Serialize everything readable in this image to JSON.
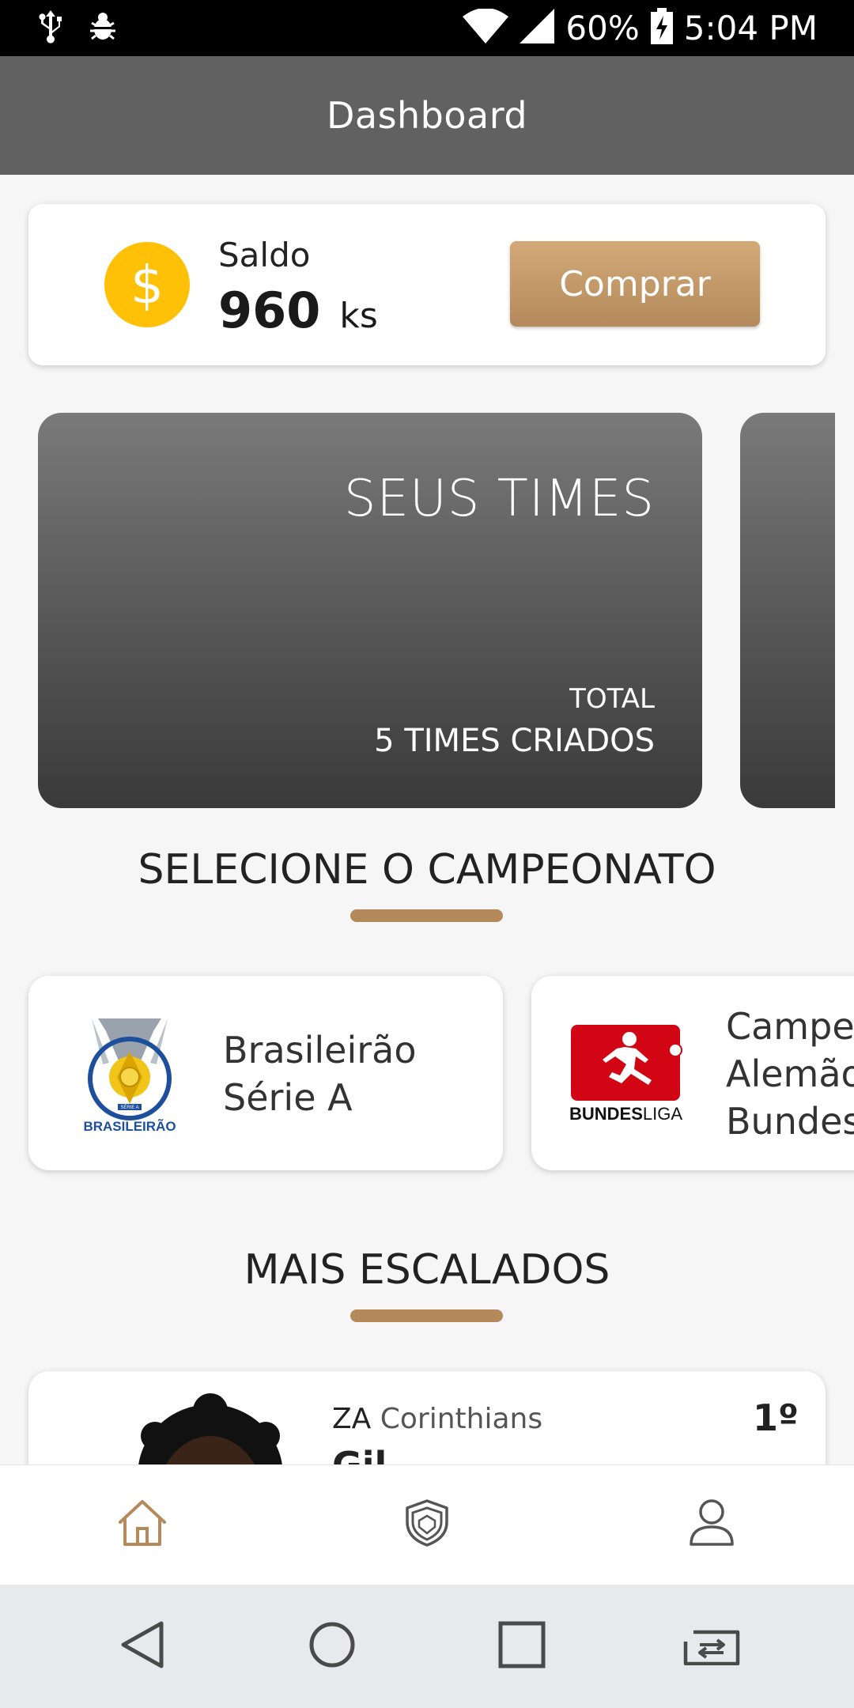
{
  "status_bar": {
    "battery": "60%",
    "time": "5:04 PM",
    "icons": [
      "usb-icon",
      "bug-icon",
      "wifi-icon",
      "signal-icon",
      "battery-charging-icon"
    ]
  },
  "app_bar": {
    "title": "Dashboard"
  },
  "balance": {
    "label": "Saldo",
    "value": "960",
    "unit": "ks",
    "coin_symbol": "$",
    "buy_label": "Comprar"
  },
  "teams_card": {
    "title": "SEUS TIMES",
    "total_label": "TOTAL",
    "total_value": "5 TIMES CRIADOS"
  },
  "championship": {
    "heading": "SELECIONE O CAMPEONATO",
    "leagues": [
      {
        "name_line1": "Brasileirão",
        "name_line2": "Série A",
        "logo_text": "BRASILEIRÃO",
        "logo_subtext": "SÉRIE A"
      },
      {
        "name_line1": "Campe",
        "name_line2": "Alemão",
        "name_line3": "Bundes",
        "logo_text_bold": "BUNDES",
        "logo_text_rest": "LIGA"
      }
    ]
  },
  "most_selected": {
    "heading": "MAIS ESCALADOS",
    "players": [
      {
        "position": "ZA",
        "club": "Corinthians",
        "name": "Gil",
        "rank": "1º"
      }
    ]
  },
  "bottom_nav": {
    "items": [
      "home-icon",
      "shield-icon",
      "profile-icon"
    ]
  },
  "colors": {
    "accent": "#b48a5c",
    "coin": "#ffc107",
    "app_bar": "#616161"
  }
}
